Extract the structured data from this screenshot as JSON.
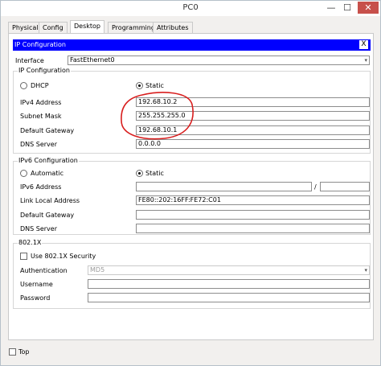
{
  "window": {
    "title": "PC0",
    "minimize": "—",
    "maximize": "☐",
    "close": "✕"
  },
  "tabs": [
    "Physical",
    "Config",
    "Desktop",
    "Programming",
    "Attributes"
  ],
  "ipconfig": {
    "header": "IP Configuration",
    "header_close": "X",
    "interface_label": "Interface",
    "interface_value": "FastEthernet0",
    "ipv4_group": "IP Configuration",
    "dhcp_label": "DHCP",
    "static_label": "Static",
    "ipv4_address_label": "IPv4 Address",
    "ipv4_address": "192.68.10.2",
    "subnet_mask_label": "Subnet Mask",
    "subnet_mask": "255.255.255.0",
    "default_gateway_label": "Default Gateway",
    "default_gateway": "192.68.10.1",
    "dns_server_label": "DNS Server",
    "dns_server": "0.0.0.0",
    "mode": "static"
  },
  "ipv6": {
    "group": "IPv6 Configuration",
    "automatic_label": "Automatic",
    "static_label": "Static",
    "address_label": "IPv6 Address",
    "address": "",
    "prefix_sep": "/",
    "prefix": "",
    "link_local_label": "Link Local Address",
    "link_local": "FE80::202:16FF:FE72:C01",
    "gateway_label": "Default Gateway",
    "gateway": "",
    "dns_label": "DNS Server",
    "dns": "",
    "mode": "static"
  },
  "dot1x": {
    "group": "802.1X",
    "use_label": "Use 802.1X Security",
    "use_checked": false,
    "auth_label": "Authentication",
    "auth_value": "MD5",
    "username_label": "Username",
    "username": "",
    "password_label": "Password",
    "password": ""
  },
  "footer": {
    "top_label": "Top",
    "top_checked": false
  },
  "colors": {
    "header_bg": "#0000ff",
    "annotation": "#d81e1e",
    "close_btn": "#c7504b"
  }
}
